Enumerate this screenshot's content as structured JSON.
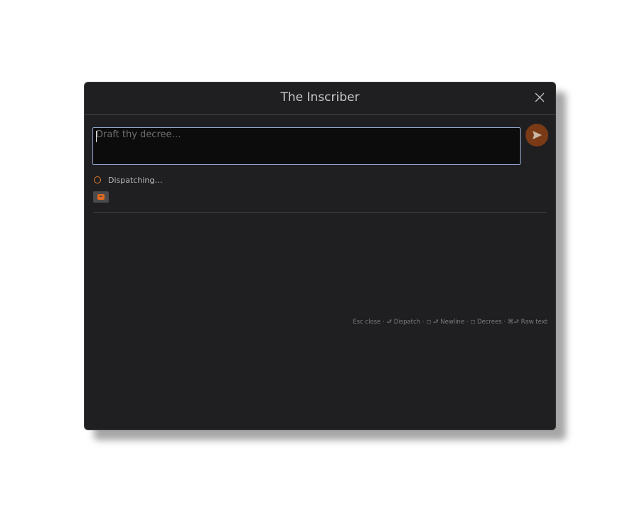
{
  "dialog": {
    "title": "The Inscriber",
    "close_icon": "close-icon"
  },
  "composer": {
    "placeholder": "Draft thy decree…",
    "value": "",
    "send_icon": "send-icon",
    "accent_color": "#7a3a16"
  },
  "status": {
    "text": "Dispatching…",
    "ring_color": "#e07a2c"
  },
  "attachment_chip": {
    "icon": "archive-box-icon",
    "color": "#e06a1e"
  },
  "hints": {
    "text": "Esc close · ⮐ Dispatch · ◻ ⮐ Newline · ◻ Decrees · ⌘⮐ Raw text"
  }
}
